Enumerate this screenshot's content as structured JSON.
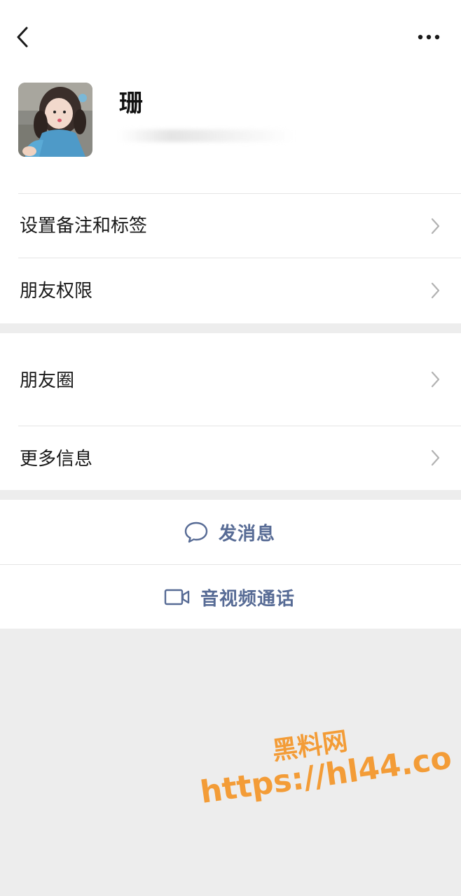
{
  "header": {
    "back_icon": "chevron-left-icon",
    "more_icon": "more-dots-icon"
  },
  "profile": {
    "name": "珊",
    "avatar": "profile-photo"
  },
  "group1": {
    "items": [
      {
        "label": "设置备注和标签",
        "icon": "chevron-right-icon"
      },
      {
        "label": "朋友权限",
        "icon": "chevron-right-icon"
      }
    ]
  },
  "group2": {
    "items": [
      {
        "label": "朋友圈",
        "icon": "chevron-right-icon"
      },
      {
        "label": "更多信息",
        "icon": "chevron-right-icon"
      }
    ]
  },
  "actions": {
    "message": {
      "label": "发消息",
      "icon": "chat-bubble-icon"
    },
    "call": {
      "label": "音视频通话",
      "icon": "video-camera-icon"
    }
  },
  "watermark": {
    "title": "黑料网",
    "url": "https://hl44.co"
  },
  "colors": {
    "background": "#ededed",
    "card": "#ffffff",
    "link": "#576b95",
    "watermark": "#f39c37",
    "divider": "#e5e5e5"
  }
}
